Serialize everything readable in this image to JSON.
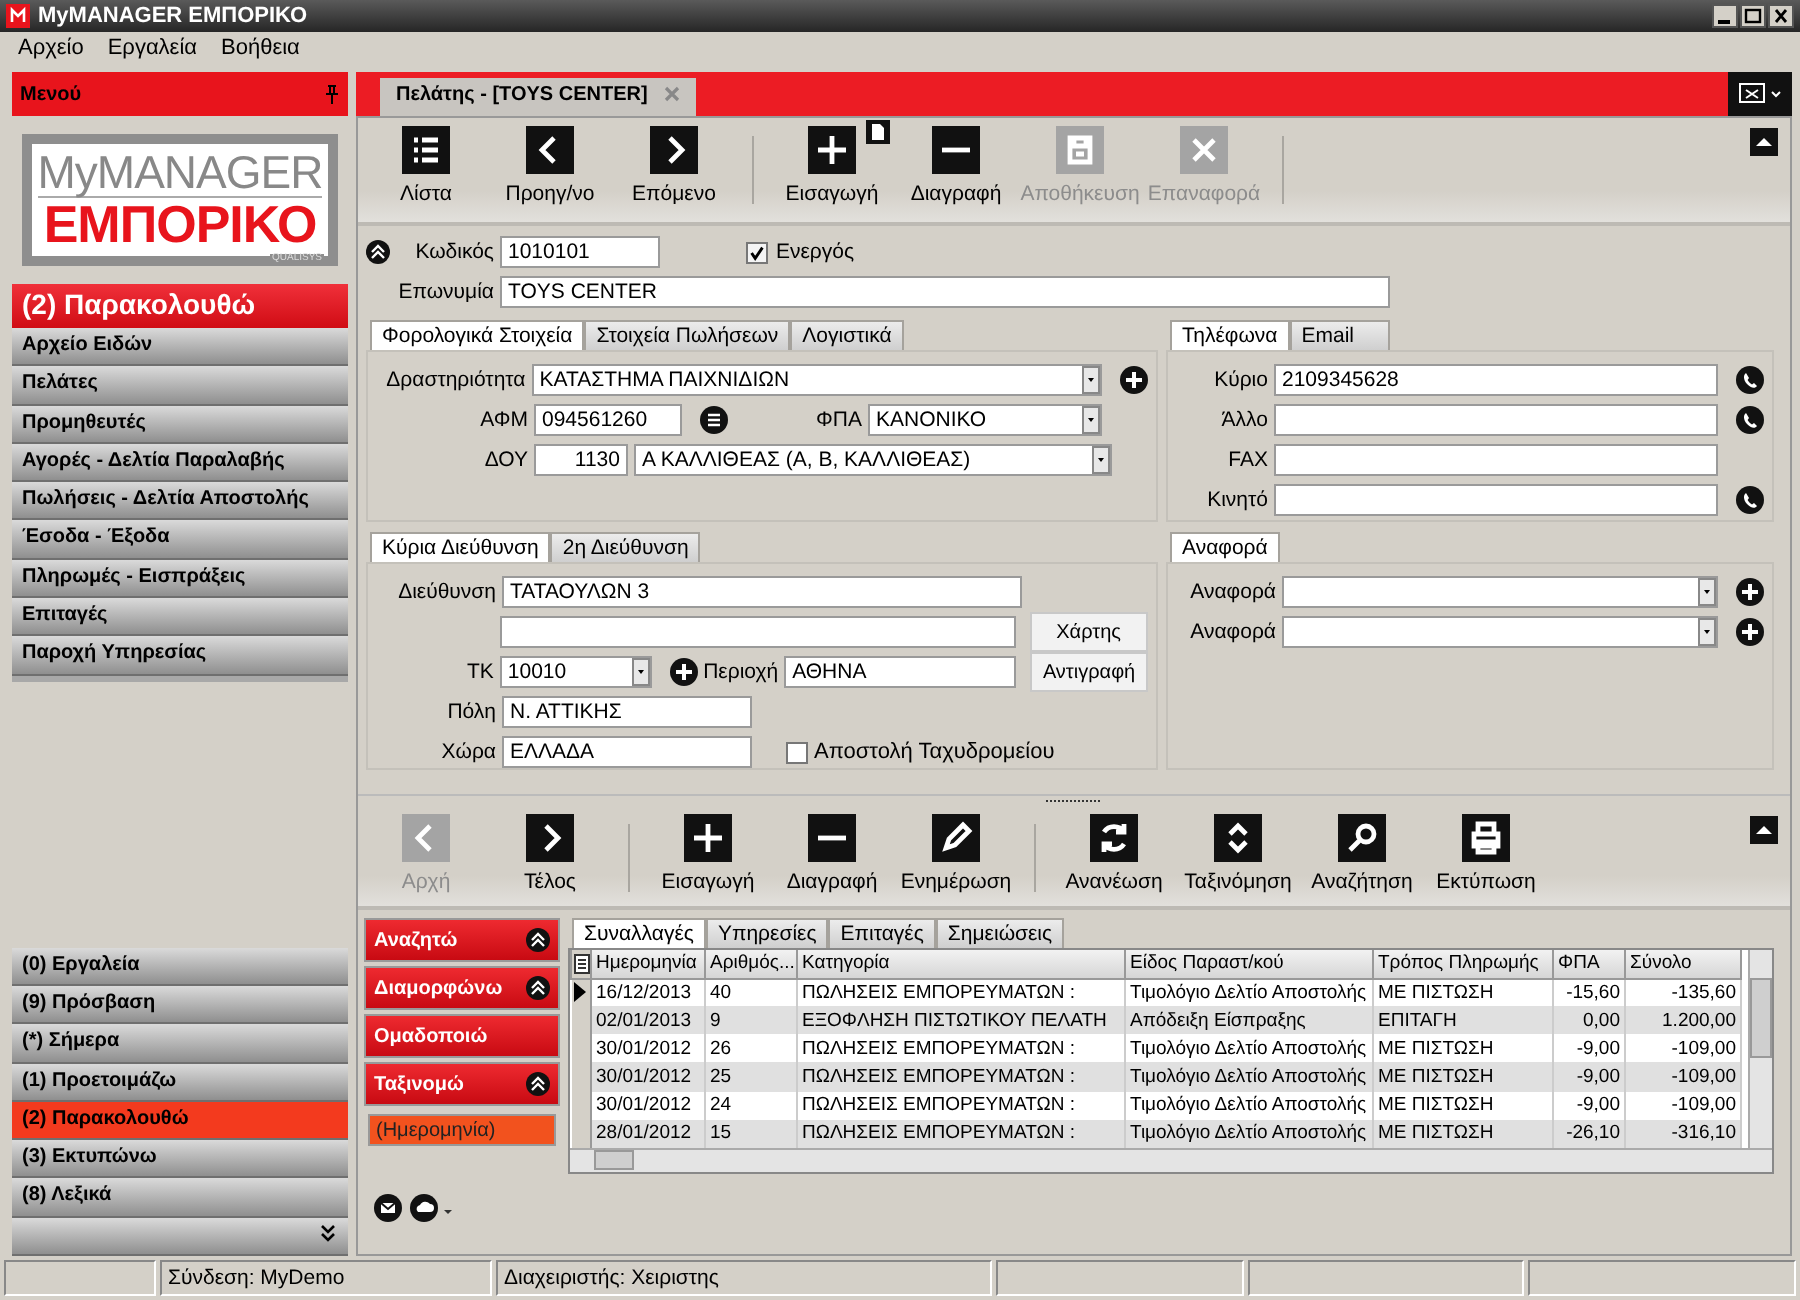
{
  "window": {
    "title": "MyMANAGER ΕΜΠΟΡΙΚΟ"
  },
  "menu_bar": [
    "Αρχείο",
    "Εργαλεία",
    "Βοήθεια"
  ],
  "sidebar": {
    "title": "Μενού",
    "logo": {
      "line1": "MyMANAGER",
      "line2": "ΕΜΠΟΡΙΚΟ",
      "maker": "QUALISYS"
    },
    "section_title": "(2) Παρακολουθώ",
    "items": [
      "Αρχείο Ειδών",
      "Πελάτες",
      "Προμηθευτές",
      "Αγορές - Δελτία Παραλαβής",
      "Πωλήσεις - Δελτία Αποστολής",
      "Έσοδα - Έξοδα",
      "Πληρωμές - Εισπράξεις",
      "Επιταγές",
      "Παροχή Υπηρεσίας"
    ],
    "nav": [
      {
        "label": "(0) Εργαλεία",
        "selected": false
      },
      {
        "label": "(9) Πρόσβαση",
        "selected": false
      },
      {
        "label": "(*) Σήμερα",
        "selected": false
      },
      {
        "label": "(1) Προετοιμάζω",
        "selected": false
      },
      {
        "label": "(2) Παρακολουθώ",
        "selected": true
      },
      {
        "label": "(3) Εκτυπώνω",
        "selected": false
      },
      {
        "label": "(8) Λεξικά",
        "selected": false
      }
    ]
  },
  "document_tab": {
    "label": "Πελάτης - [TOYS CENTER]"
  },
  "toolbar": [
    {
      "label": "Λίστα",
      "kind": "list",
      "disabled": false,
      "separator_after": false
    },
    {
      "label": "Προηγ/νο",
      "kind": "chevron-left",
      "disabled": false,
      "separator_after": false
    },
    {
      "label": "Επόμενο",
      "kind": "chevron-right",
      "disabled": false,
      "separator_after": true
    },
    {
      "label": "Εισαγωγή",
      "kind": "plus",
      "disabled": false,
      "separator_after": false
    },
    {
      "label": "Διαγραφή",
      "kind": "minus",
      "disabled": false,
      "separator_after": false
    },
    {
      "label": "Αποθήκευση",
      "kind": "floppy",
      "disabled": true,
      "separator_after": false
    },
    {
      "label": "Επαναφορά",
      "kind": "cross",
      "disabled": true,
      "separator_after": true
    }
  ],
  "customer": {
    "code": {
      "label": "Κωδικός",
      "value": "1010101"
    },
    "active": {
      "label": "Ενεργός",
      "checked": true
    },
    "name": {
      "label": "Επωνυμία",
      "value": "TOYS CENTER"
    }
  },
  "tax_panel": {
    "tabs": [
      {
        "label": "Φορολογικά Στοιχεία",
        "selected": true
      },
      {
        "label": "Στοιχεία Πωλήσεων",
        "selected": false
      },
      {
        "label": "Λογιστικά",
        "selected": false
      }
    ],
    "activity": {
      "label": "Δραστηριότητα",
      "value": "ΚΑΤΑΣΤΗΜΑ ΠΑΙΧΝΙΔΙΩΝ"
    },
    "afm": {
      "label": "ΑΦΜ",
      "value": "094561260"
    },
    "vat": {
      "label": "ΦΠΑ",
      "value": "ΚΑΝΟΝΙΚΟ"
    },
    "tax_office": {
      "label": "ΔΟΥ",
      "code": "1130",
      "value": "Α ΚΑΛΛΙΘΕΑΣ (Α, Β, ΚΑΛΛΙΘΕΑΣ)"
    }
  },
  "phone_panel": {
    "tabs": [
      {
        "label": "Τηλέφωνα",
        "selected": true
      },
      {
        "label": "Email",
        "selected": false
      }
    ],
    "phones": [
      {
        "label": "Κύριο",
        "value": "2109345628",
        "dial": true
      },
      {
        "label": "Άλλο",
        "dial": true
      },
      {
        "label": "FAX",
        "dial": false
      },
      {
        "label": "Κινητό",
        "dial": true
      }
    ]
  },
  "address_panel": {
    "tabs": [
      {
        "label": "Κύρια Διεύθυνση",
        "selected": true
      },
      {
        "label": "2η Διεύθυνση",
        "selected": false
      }
    ],
    "address": {
      "label": "Διεύθυνση",
      "value": "ΤΑΤΑΟΥΛΩΝ 3"
    },
    "postcode": {
      "label": "ΤΚ",
      "value": "10010"
    },
    "area": {
      "label": "Περιοχή",
      "value": "ΑΘΗΝΑ"
    },
    "city": {
      "label": "Πόλη",
      "value": "Ν. ΑΤΤΙΚΗΣ"
    },
    "country": {
      "label": "Χώρα",
      "value": "ΕΛΛΑΔΑ"
    },
    "mail_delivery": {
      "label": "Αποστολή Ταχυδρομείου",
      "checked": false
    },
    "buttons": [
      "Χάρτης",
      "Αντιγραφή"
    ]
  },
  "reference_panel": {
    "tabs": [
      {
        "label": "Αναφορά",
        "selected": true
      }
    ],
    "fields": [
      {
        "label": "Αναφορά"
      },
      {
        "label": "Αναφορά"
      }
    ]
  },
  "list_toolbar": [
    {
      "label": "Αρχή",
      "kind": "chevron-left",
      "disabled": true,
      "separator_after": false
    },
    {
      "label": "Τέλος",
      "kind": "chevron-right",
      "disabled": false,
      "separator_after": true
    },
    {
      "label": "Εισαγωγή",
      "kind": "plus",
      "disabled": false,
      "separator_after": false
    },
    {
      "label": "Διαγραφή",
      "kind": "minus",
      "disabled": false,
      "separator_after": false
    },
    {
      "label": "Ενημέρωση",
      "kind": "pencil",
      "disabled": false,
      "separator_after": true
    },
    {
      "label": "Ανανέωση",
      "kind": "refresh",
      "disabled": false,
      "separator_after": false
    },
    {
      "label": "Ταξινόμηση",
      "kind": "sort",
      "disabled": false,
      "separator_after": false
    },
    {
      "label": "Αναζήτηση",
      "kind": "search",
      "disabled": false,
      "separator_after": false
    },
    {
      "label": "Εκτύπωση",
      "kind": "printer",
      "disabled": false,
      "separator_after": false
    }
  ],
  "filter_panel": {
    "groups": [
      {
        "label": "Αναζητώ",
        "collapsible": true
      },
      {
        "label": "Διαμορφώνω",
        "collapsible": true
      },
      {
        "label": "Ομαδοποιώ",
        "collapsible": false
      },
      {
        "label": "Ταξινομώ",
        "collapsible": true
      }
    ],
    "sort_field": "(Ημερομηνία)"
  },
  "grid_tabs": [
    {
      "label": "Συναλλαγές",
      "selected": true
    },
    {
      "label": "Υπηρεσίες",
      "selected": false
    },
    {
      "label": "Επιταγές",
      "selected": false
    },
    {
      "label": "Σημειώσεις",
      "selected": false
    }
  ],
  "table": {
    "columns": [
      "Ημερομηνία",
      "Αριθμός...",
      "Κατηγορία",
      "Είδος Παραστ/κού",
      "Τρόπος Πληρωμής",
      "ΦΠΑ",
      "Σύνολο"
    ],
    "rows": [
      {
        "current": true,
        "cells": [
          "16/12/2013",
          "40",
          "ΠΩΛΗΣΕΙΣ ΕΜΠΟΡΕΥΜΑΤΩΝ :",
          "Τιμολόγιο Δελτίο Αποστολής",
          "ΜΕ ΠΙΣΤΩΣΗ",
          "-15,60",
          "-135,60"
        ]
      },
      {
        "current": false,
        "cells": [
          "02/01/2013",
          "9",
          "ΕΞΟΦΛΗΣΗ ΠΙΣΤΩΤΙΚΟΥ ΠΕΛΑΤΗ",
          "Απόδειξη Είσπραξης",
          "ΕΠΙΤΑΓΗ",
          "0,00",
          "1.200,00"
        ]
      },
      {
        "current": false,
        "cells": [
          "30/01/2012",
          "26",
          "ΠΩΛΗΣΕΙΣ ΕΜΠΟΡΕΥΜΑΤΩΝ :",
          "Τιμολόγιο Δελτίο Αποστολής",
          "ΜΕ ΠΙΣΤΩΣΗ",
          "-9,00",
          "-109,00"
        ]
      },
      {
        "current": false,
        "cells": [
          "30/01/2012",
          "25",
          "ΠΩΛΗΣΕΙΣ ΕΜΠΟΡΕΥΜΑΤΩΝ :",
          "Τιμολόγιο Δελτίο Αποστολής",
          "ΜΕ ΠΙΣΤΩΣΗ",
          "-9,00",
          "-109,00"
        ]
      },
      {
        "current": false,
        "cells": [
          "30/01/2012",
          "24",
          "ΠΩΛΗΣΕΙΣ ΕΜΠΟΡΕΥΜΑΤΩΝ :",
          "Τιμολόγιο Δελτίο Αποστολής",
          "ΜΕ ΠΙΣΤΩΣΗ",
          "-9,00",
          "-109,00"
        ]
      },
      {
        "current": false,
        "cells": [
          "28/01/2012",
          "15",
          "ΠΩΛΗΣΕΙΣ ΕΜΠΟΡΕΥΜΑΤΩΝ :",
          "Τιμολόγιο Δελτίο Αποστολής",
          "ΜΕ ΠΙΣΤΩΣΗ",
          "-26,10",
          "-316,10"
        ]
      }
    ]
  },
  "status_bar": {
    "connection": "Σύνδεση: MyDemo",
    "user": "Διαχειριστής: Χειριστης"
  }
}
